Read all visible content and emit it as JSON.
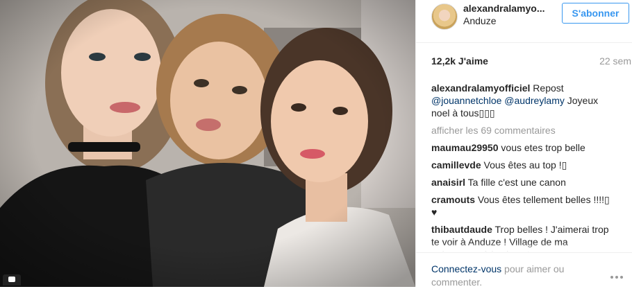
{
  "header": {
    "username": "alexandralamyo...",
    "location": "Anduze",
    "follow_label": "S'abonner"
  },
  "stats": {
    "likes": "12,2k J'aime",
    "age": "22 sem"
  },
  "caption": {
    "user": "alexandralamyofficiel",
    "text_1": " Repost ",
    "mention_1": "@jouannetchloe",
    "text_2": " ",
    "mention_2": "@audreylamy",
    "text_3": " Joyeux noel à tous▯▯▯"
  },
  "load_more": "afficher les 69 commentaires",
  "comments": [
    {
      "user": "maumau29950",
      "text": " vous etes trop belle"
    },
    {
      "user": "camillevde",
      "text": " Vous êtes au top !▯"
    },
    {
      "user": "anaisirl",
      "text": " Ta fille c'est une canon"
    },
    {
      "user": "cramouts",
      "text": " Vous êtes tellement belles !!!!▯ ♥"
    },
    {
      "user": "thibautdaude",
      "text": " Trop belles ! J'aimerai trop te voir à Anduze ! Village de ma naissance où je viens tous..."
    }
  ],
  "footer": {
    "login_link": "Connectez-vous",
    "login_rest": " pour aimer ou commenter."
  },
  "colors": {
    "accent": "#3897f0",
    "link": "#003569",
    "muted": "#999999"
  }
}
